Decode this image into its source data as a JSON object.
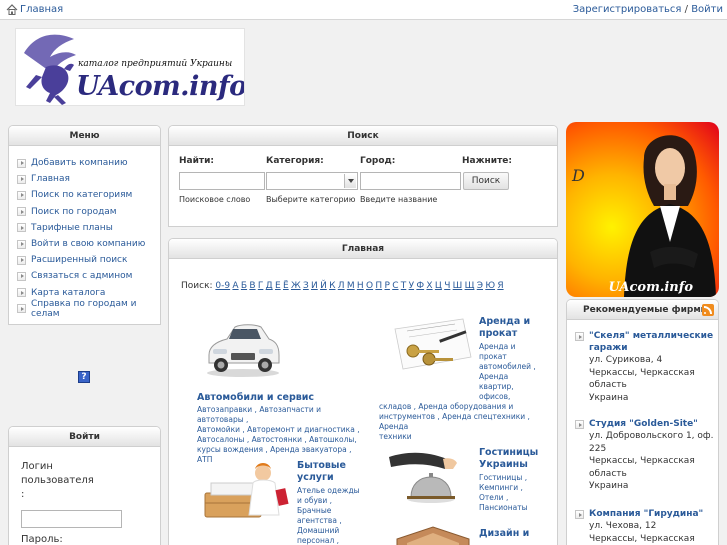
{
  "topbar": {
    "home": "Главная",
    "register": "Зарегистрироваться",
    "sep": " / ",
    "login": "Войти"
  },
  "logo": {
    "tagline": "каталог предприятий Украины",
    "brand": "UAcom.info"
  },
  "menu": {
    "title": "Меню",
    "items": [
      "Добавить компанию",
      "Главная",
      "Поиск по категориям",
      "Поиск по городам",
      "Тарифные планы",
      "Войти в свою компанию",
      "Расширенный поиск",
      "Связаться с админом",
      "Карта каталога",
      "Справка по городам и селам"
    ]
  },
  "help_badge": "?",
  "login": {
    "title": "Войти",
    "username_label": "Логин пользователя :",
    "password_label": "Пароль:"
  },
  "search": {
    "title": "Поиск",
    "find_label": "Найти:",
    "category_label": "Категория:",
    "city_label": "Город:",
    "press_label": "Нажните:",
    "find_hint": "Поисковое слово",
    "category_hint": "Выберите категорию",
    "city_hint": "Введите название",
    "button": "Поиск"
  },
  "main": {
    "title": "Главная",
    "alpha_label": "Поиск:",
    "letters": [
      "0-9",
      "А",
      "Б",
      "В",
      "Г",
      "Д",
      "Е",
      "Ё",
      "Ж",
      "З",
      "И",
      "Й",
      "К",
      "Л",
      "М",
      "Н",
      "О",
      "П",
      "Р",
      "С",
      "Т",
      "У",
      "Ф",
      "Х",
      "Ц",
      "Ч",
      "Ш",
      "Щ",
      "Э",
      "Ю",
      "Я"
    ],
    "cats": {
      "auto": {
        "title": "Автомобили и сервис",
        "l1": "Автозаправки , Автозапчасти и автотовары ,",
        "l2": "Автомойки , Авторемонт и диагностика ,",
        "l3": "Автосалоны , Автостоянки , Автошколы,",
        "l4": "курсы вождения , Аренда эвакуатора , АТП"
      },
      "rent": {
        "title1": "Аренда и",
        "title2": "прокат",
        "l1": "Аренда и",
        "l2": "прокат",
        "l3": "автомобилей ,",
        "l4": "Аренда",
        "l5": "квартир,",
        "l6": "офисов,",
        "l7": "складов , Аренда оборудования и",
        "l8": "инструментов , Аренда спецтехники , Аренда",
        "l9": "техники"
      },
      "home": {
        "title1": "Бытовые",
        "title2": "услуги",
        "l1": "Ателье одежды",
        "l2": "и обуви ,",
        "l3": "Брачные",
        "l4": "агентства ,",
        "l5": "Домашний",
        "l6": "персонал ,"
      },
      "hotel": {
        "title1": "Гостиницы",
        "title2": "Украины",
        "l1": "Гостиницы ,",
        "l2": "Кемпинги ,",
        "l3": "Отели ,",
        "l4": "Пансионаты"
      },
      "design": {
        "title1": "Дизайн и"
      }
    }
  },
  "ad": {
    "signature": "D",
    "brand": "UAcom.info"
  },
  "recommended": {
    "title": "Рекомендуемые фирмы",
    "items": [
      {
        "name": "\"Скеля\" металлические гаражи",
        "lines": [
          "ул. Сурикова, 4",
          "Черкассы, Черкасская область",
          "Украина"
        ]
      },
      {
        "name": "Студия \"Golden-Site\"",
        "lines": [
          "ул. Добровольского 1, оф. 225",
          "Черкассы, Черкасская область",
          "Украина"
        ]
      },
      {
        "name": "Компания \"Гирудина\"",
        "lines": [
          "ул. Чехова, 12",
          "Черкассы, Черкасская"
        ]
      }
    ]
  },
  "colors": {
    "link": "#2a5a99",
    "brand": "#2b2a7e",
    "page_bg": "#f1f1f1"
  }
}
